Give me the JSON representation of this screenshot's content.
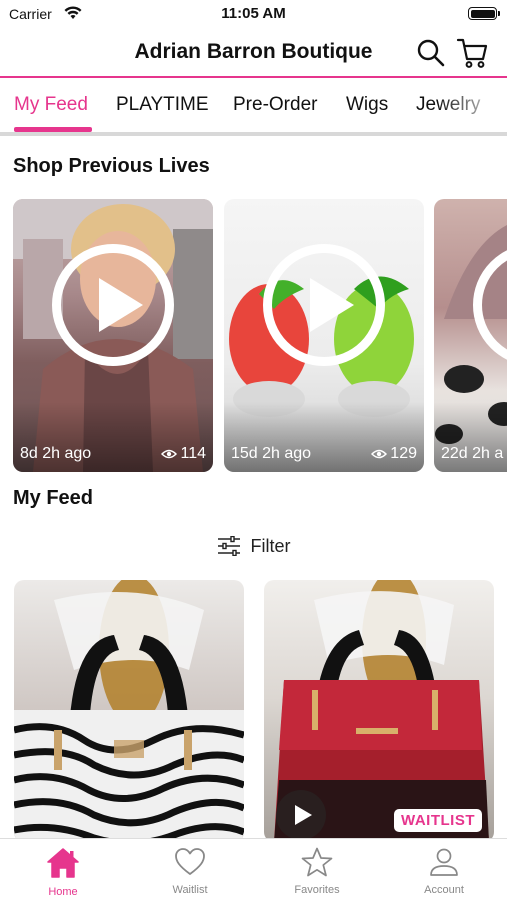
{
  "status_bar": {
    "carrier": "Carrier",
    "time": "11:05 AM"
  },
  "header": {
    "title": "Adrian Barron Boutique"
  },
  "tabs": [
    {
      "label": "My Feed",
      "active": true
    },
    {
      "label": "PLAYTIME"
    },
    {
      "label": "Pre-Order"
    },
    {
      "label": "Wigs"
    },
    {
      "label": "Jewelry"
    }
  ],
  "previous_lives": {
    "title": "Shop Previous Lives",
    "items": [
      {
        "ago": "8d 2h ago",
        "views": "114"
      },
      {
        "ago": "15d 2h ago",
        "views": "129"
      },
      {
        "ago": "22d 2h a"
      }
    ]
  },
  "feed": {
    "title": "My Feed",
    "filter_label": "Filter",
    "items": [
      {
        "badge": ""
      },
      {
        "badge": "WAITLIST"
      }
    ]
  },
  "bottom_nav": [
    {
      "label": "Home",
      "active": true
    },
    {
      "label": "Waitlist"
    },
    {
      "label": "Favorites"
    },
    {
      "label": "Account"
    }
  ],
  "colors": {
    "accent": "#e6358d",
    "tab_divider": "#d8d8d8",
    "nav_inactive": "#888888"
  }
}
